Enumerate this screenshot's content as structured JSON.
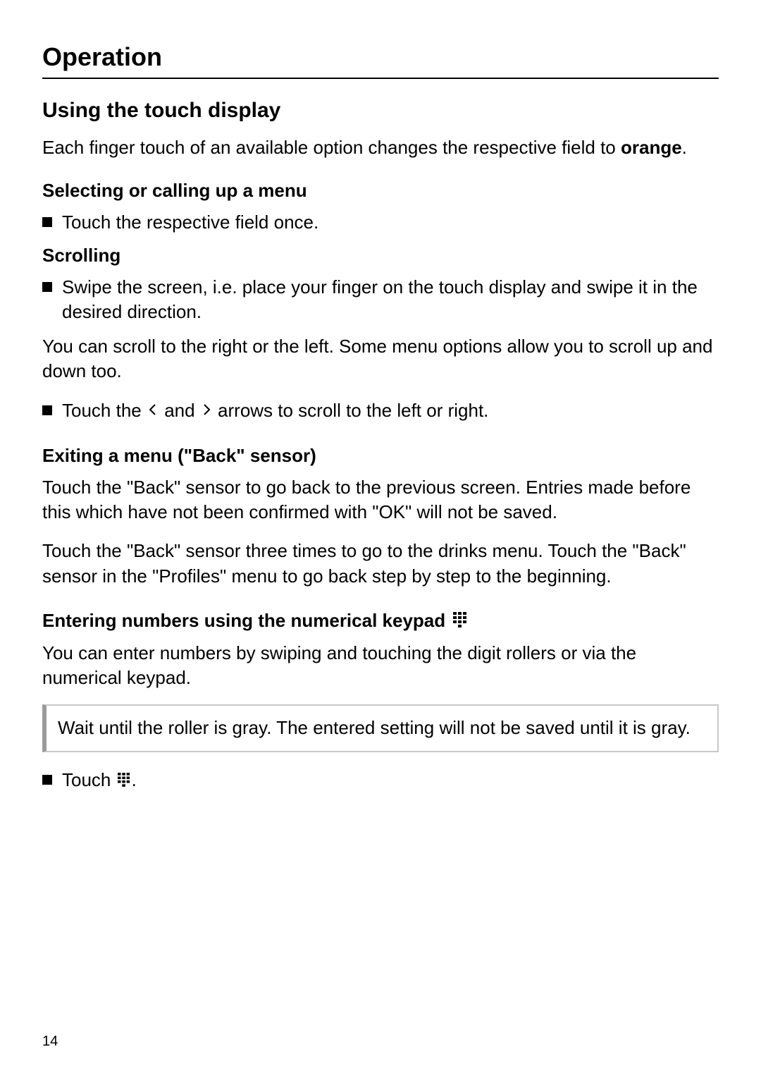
{
  "page_number": "14",
  "chapter_title": "Operation",
  "section_title": "Using the touch display",
  "intro_prefix": "Each finger touch of an available option changes the respective field to ",
  "intro_bold": "orange",
  "intro_suffix": ".",
  "sub1": {
    "title": "Selecting or calling up a menu",
    "bullet1": "Touch the respective field once."
  },
  "sub2": {
    "title": "Scrolling",
    "bullet1": "Swipe the screen, i.e. place your finger on the touch display and swipe it in the desired direction.",
    "para1": "You can scroll to the right or the left. Some menu options allow you to scroll up and down too.",
    "arrow_prefix": "Touch the ",
    "arrow_mid": " and ",
    "arrow_suffix": " arrows to scroll to the left or right."
  },
  "sub3": {
    "title": "Exiting a menu (\"Back\" sensor)",
    "para1": "Touch the \"Back\" sensor to go back to the previous screen. Entries made before this which have not been confirmed with \"OK\" will not be saved.",
    "para2": "Touch the \"Back\" sensor three times to go to the drinks menu. Touch the \"Back\" sensor in the \"Profiles\" menu to go back step by step to the beginning."
  },
  "sub4": {
    "title": "Entering numbers using the numerical keypad ",
    "para1": "You can enter numbers by swiping and touching the digit rollers or via the numerical keypad.",
    "note": "Wait until the roller is gray. The entered setting will not be saved until it is gray.",
    "touch_prefix": "Touch ",
    "touch_suffix": "."
  }
}
